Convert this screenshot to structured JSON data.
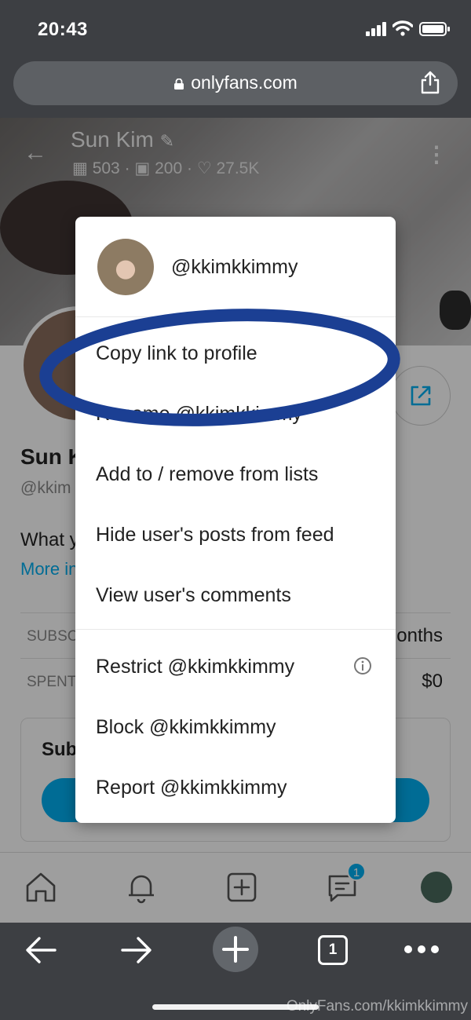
{
  "status_bar": {
    "time": "20:43"
  },
  "browser": {
    "url": "onlyfans.com",
    "tab_count": "1"
  },
  "profile": {
    "name": "Sun Kim",
    "stats": {
      "photos": "503",
      "videos": "200",
      "likes": "27.5K"
    },
    "name_partial": "Sun K",
    "handle_partial": "@kkim",
    "bio_partial": "What y",
    "more_info_partial": "More in",
    "rows": [
      {
        "label": "SUBSC",
        "value": "onths"
      },
      {
        "label": "SPENT",
        "value": "$0"
      }
    ],
    "subscribe_partial": "Sub",
    "notifications_badge": "1"
  },
  "menu": {
    "handle": "@kkimkkimmy",
    "items": [
      "Copy link to profile",
      "Rename @kkimkkimmy",
      "Add to / remove from lists",
      "Hide user's posts from feed",
      "View user's comments",
      "Restrict @kkimkkimmy",
      "Block @kkimkkimmy",
      "Report @kkimkkimmy"
    ]
  },
  "annotation": {
    "color": "#1b3f93"
  },
  "watermark": "OnlyFans.com/kkimkkimmy",
  "colors": {
    "accent": "#00aff0",
    "chrome": "#3d3f43"
  }
}
